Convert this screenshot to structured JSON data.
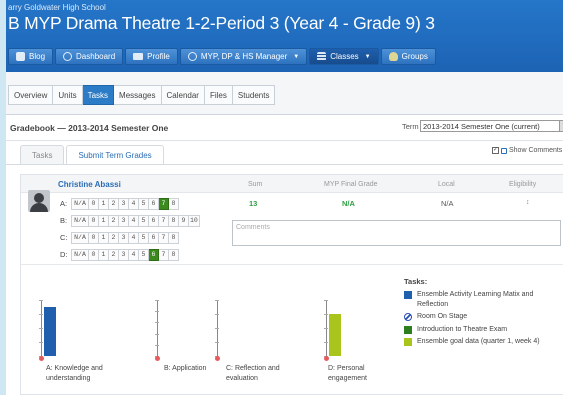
{
  "header": {
    "school": "arry Goldwater High School",
    "course_title": "B MYP Drama Theatre 1-2-Period 3 (Year 4 - Grade 9) 3"
  },
  "nav": [
    {
      "label": "Blog",
      "icon": "blog-icon"
    },
    {
      "label": "Dashboard",
      "icon": "clock-icon"
    },
    {
      "label": "Profile",
      "icon": "id-card-icon"
    },
    {
      "label": "MYP, DP & HS Manager",
      "icon": "globe-icon"
    },
    {
      "label": "Classes",
      "icon": "grid-icon"
    },
    {
      "label": "Groups",
      "icon": "bulb-icon"
    }
  ],
  "tabs": [
    "Overview",
    "Units",
    "Tasks",
    "Messages",
    "Calendar",
    "Files",
    "Students"
  ],
  "active_tab": "Tasks",
  "gradebook": {
    "title": "Gradebook — 2013-2014 Semester One",
    "term_label": "Term",
    "term_value": "2013-2014 Semester One (current)"
  },
  "subtabs": [
    "Tasks",
    "Submit Term Grades"
  ],
  "show_comments": "Show Comments",
  "columns": {
    "sum": "Sum",
    "myp": "MYP Final Grade",
    "local": "Local",
    "eligibility": "Eligibility"
  },
  "student": {
    "name": "Christine Abassi",
    "criteria": [
      {
        "label": "A:",
        "options": [
          "N/A",
          "0",
          "1",
          "2",
          "3",
          "4",
          "5",
          "6",
          "7",
          "8"
        ],
        "selected": "7"
      },
      {
        "label": "B:",
        "options": [
          "N/A",
          "0",
          "1",
          "2",
          "3",
          "4",
          "5",
          "6",
          "7",
          "8",
          "9",
          "10"
        ],
        "selected": ""
      },
      {
        "label": "C:",
        "options": [
          "N/A",
          "0",
          "1",
          "2",
          "3",
          "4",
          "5",
          "6",
          "7",
          "8"
        ],
        "selected": ""
      },
      {
        "label": "D:",
        "options": [
          "N/A",
          "0",
          "1",
          "2",
          "3",
          "4",
          "5",
          "6",
          "7",
          "8"
        ],
        "selected": "6"
      }
    ],
    "sum": "13",
    "myp_final": "N/A",
    "local": "N/A",
    "eligibility": "↕",
    "comments_placeholder": "Comments"
  },
  "charts": [
    {
      "label": "A: Knowledge and understanding",
      "max": 8,
      "value": 7,
      "color": "#1f5fad"
    },
    {
      "label": "B: Application",
      "max": 10,
      "value": 0,
      "color": "#1f5fad"
    },
    {
      "label": "C: Reflection and evaluation",
      "max": 8,
      "value": 0,
      "color": "#1f5fad"
    },
    {
      "label": "D: Personal engagement",
      "max": 8,
      "value": 6,
      "color": "#a9c41a"
    }
  ],
  "legend": {
    "title": "Tasks:",
    "items": [
      {
        "label": "Ensemble Activity Learning Matix and Reflection",
        "color": "#1f5fad",
        "style": "solid"
      },
      {
        "label": "Room On Stage",
        "color": "#2a4fb5",
        "style": "stripe"
      },
      {
        "label": "Introduction to Theatre Exam",
        "color": "#2e7d1e",
        "style": "solid"
      },
      {
        "label": "Ensemble goal data (quarter 1, week 4)",
        "color": "#a9c41a",
        "style": "solid"
      }
    ]
  }
}
